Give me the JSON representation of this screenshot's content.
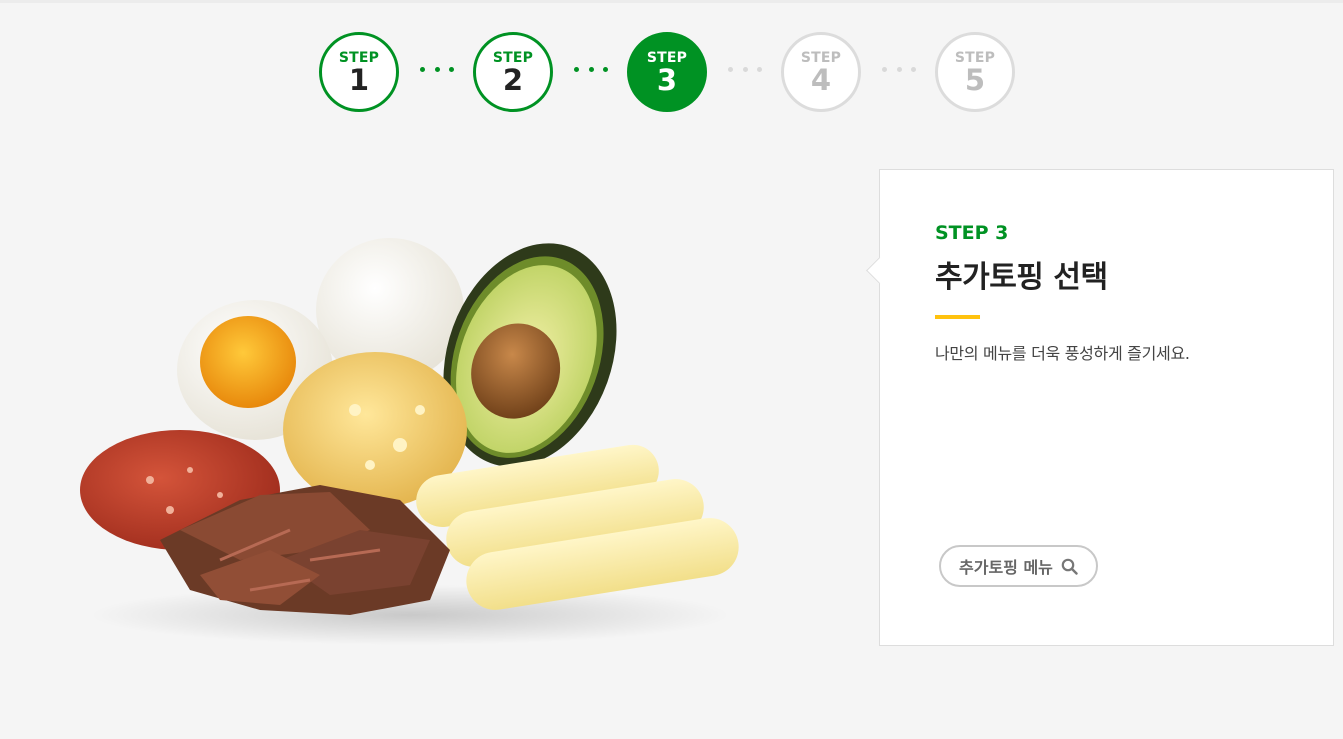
{
  "steps": [
    {
      "label": "STEP",
      "number": "1",
      "state": "done"
    },
    {
      "label": "STEP",
      "number": "2",
      "state": "done"
    },
    {
      "label": "STEP",
      "number": "3",
      "state": "active"
    },
    {
      "label": "STEP",
      "number": "4",
      "state": "todo"
    },
    {
      "label": "STEP",
      "number": "5",
      "state": "todo"
    }
  ],
  "card": {
    "step_tag": "STEP 3",
    "title": "추가토핑 선택",
    "description": "나만의 메뉴를 더욱 풍성하게 즐기세요.",
    "menu_button": "추가토핑 메뉴",
    "menu_button_icon": "search-icon"
  },
  "image": {
    "subject": "toppings-photo",
    "items": [
      "boiled-egg",
      "egg-mayo",
      "avocado",
      "pepperoni",
      "steak",
      "cheese-slices"
    ]
  },
  "colors": {
    "accent": "#009223",
    "highlight": "#ffc20e",
    "inactive": "#d9d9d9",
    "background": "#f5f5f5"
  }
}
